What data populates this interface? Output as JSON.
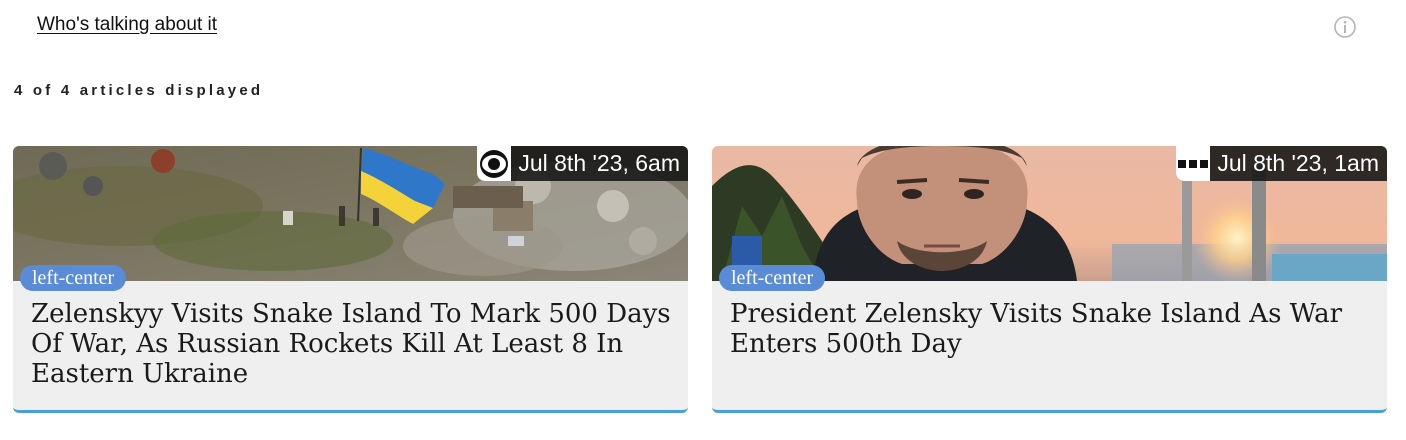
{
  "header": {
    "link_label": "Who's talking about it",
    "info_icon": "info-circle-icon"
  },
  "article_count_text": "4 of 4 articles displayed",
  "articles": [
    {
      "date": "Jul 8th '23, 6am",
      "source_icon": "cbs-eye-logo-icon",
      "bias": "left-center",
      "title": "Zelenskyy Visits Snake Island To Mark 500 Days Of War, As Russian Rockets Kill At Least 8 In Eastern Ukraine",
      "image": "aerial-island-ukrainian-flag"
    },
    {
      "date": "Jul 8th '23, 1am",
      "source_icon": "three-bar-logo-icon",
      "bias": "left-center",
      "title": "President Zelensky Visits Snake Island As War Enters 500th Day",
      "image": "zelensky-sunset-selfie"
    }
  ],
  "colors": {
    "bias_pill": "#5a8bd6",
    "card_border": "#4a9fd8",
    "card_bg": "#efefef"
  }
}
